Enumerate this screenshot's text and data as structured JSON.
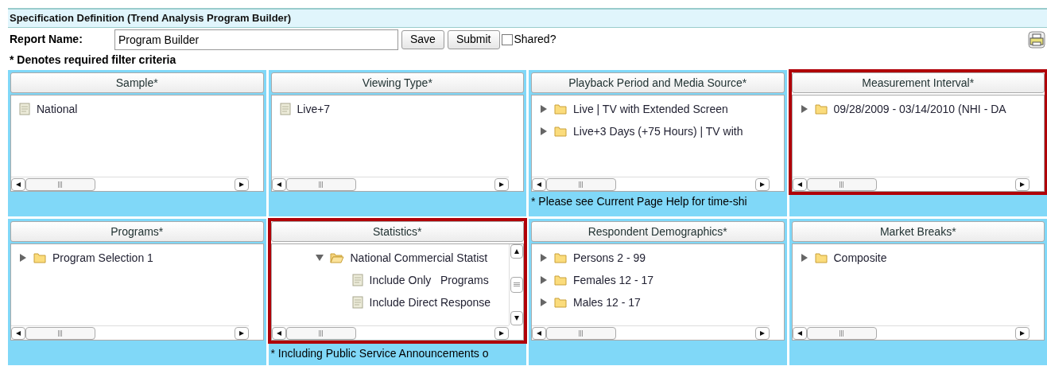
{
  "title": "Specification Definition (Trend Analysis Program Builder)",
  "report": {
    "label": "Report Name:",
    "value": "Program Builder",
    "buttons": [
      "Save",
      "Submit"
    ],
    "shared": {
      "label": "Shared?",
      "checked": false
    }
  },
  "required_note": "* Denotes required filter criteria",
  "panels": [
    {
      "title": "Sample*",
      "highlighted": false,
      "items": [
        {
          "kind": "doc",
          "label": "National"
        }
      ]
    },
    {
      "title": "Viewing Type*",
      "highlighted": false,
      "items": [
        {
          "kind": "doc",
          "label": "Live+7"
        }
      ]
    },
    {
      "title": "Playback Period and Media Source*",
      "highlighted": false,
      "note": "* Please see Current Page Help for time-shi",
      "items": [
        {
          "kind": "folder",
          "label": "Live | TV with Extended Screen",
          "expanded": false
        },
        {
          "kind": "folder",
          "label": "Live+3 Days (+75 Hours) | TV with",
          "expanded": false
        }
      ]
    },
    {
      "title": "Measurement Interval*",
      "highlighted": true,
      "items": [
        {
          "kind": "folder",
          "label": "09/28/2009 - 03/14/2010 (NHI - DA",
          "expanded": false
        }
      ]
    },
    {
      "title": "Programs*",
      "highlighted": false,
      "items": [
        {
          "kind": "folder",
          "label": "Program Selection 1",
          "expanded": false
        }
      ]
    },
    {
      "title": "Statistics*",
      "highlighted": true,
      "note": "* Including Public Service Announcements o",
      "items": [
        {
          "kind": "folder",
          "label": "National Commercial Statist",
          "expanded": true,
          "children": [
            {
              "kind": "doc",
              "label": "Include Only   Programs"
            },
            {
              "kind": "doc",
              "label": "Include Direct Response"
            }
          ]
        }
      ]
    },
    {
      "title": "Respondent Demographics*",
      "highlighted": false,
      "items": [
        {
          "kind": "folder",
          "label": "Persons 2 - 99",
          "expanded": false
        },
        {
          "kind": "folder",
          "label": "Females 12 - 17",
          "expanded": false
        },
        {
          "kind": "folder",
          "label": "Males 12 - 17",
          "expanded": false
        }
      ]
    },
    {
      "title": "Market Breaks*",
      "highlighted": false,
      "items": [
        {
          "kind": "folder",
          "label": "Composite",
          "expanded": false
        }
      ]
    }
  ]
}
